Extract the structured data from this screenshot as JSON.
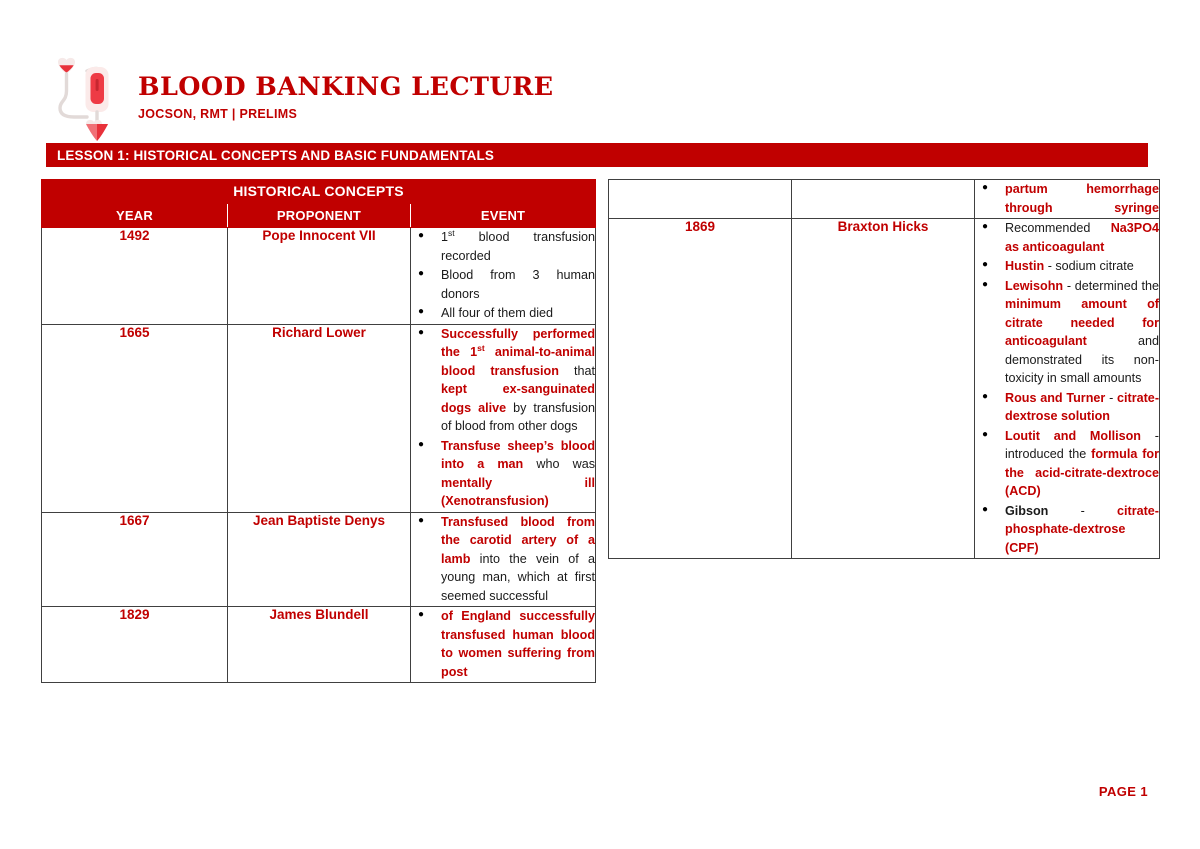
{
  "header": {
    "title": "BLOOD BANKING LECTURE",
    "subtitle": "JOCSON, RMT | PRELIMS",
    "logo_icon": "blood-bag-iv-drip-icon"
  },
  "lesson_banner": {
    "label": "LESSON 1: HISTORICAL CONCEPTS AND BASIC FUNDAMENTALS"
  },
  "colors": {
    "brand_red": "#C00000",
    "banner_bg": "#C00000",
    "header_text": "#FFFFFF",
    "body_text": "#1A1A1A",
    "border": "#404040"
  },
  "left_table": {
    "title": "HISTORICAL CONCEPTS",
    "columns": [
      "YEAR",
      "PROPONENT",
      "EVENT"
    ],
    "rows": [
      {
        "year": "1492",
        "proponent": "Pope Innocent VII",
        "events": [
          "1st blood transfusion recorded",
          "Blood from 3 human donors",
          "All four of them died"
        ]
      },
      {
        "year": "1665",
        "proponent": "Richard Lower",
        "events": [
          "Successfully performed the 1st animal-to-animal blood transfusion that kept ex-sanguinated dogs alive by transfusion of blood from other dogs",
          "Transfuse sheep’s blood into a man who was mentally ill (Xenotransfusion)"
        ]
      },
      {
        "year": "1667",
        "proponent": "Jean Baptiste Denys",
        "events": [
          "Transfused blood from the carotid artery of a lamb into the vein of a young man, which at first seemed successful"
        ]
      },
      {
        "year": "1829",
        "proponent": "James Blundell",
        "events": [
          "of England successfully transfused human blood to women suffering from post"
        ]
      }
    ]
  },
  "right_table": {
    "rows": [
      {
        "year": "",
        "proponent": "",
        "events": [
          "partum hemorrhage through syringe"
        ]
      },
      {
        "year": "1869",
        "proponent": "Braxton Hicks",
        "events": [
          "Recommended Na3PO4 as anticoagulant",
          "Hustin - sodium citrate",
          "Lewisohn - determined the minimum amount of citrate needed for anticoagulant and demonstrated its non-toxicity in small amounts",
          "Rous and Turner - citrate-dextrose solution",
          "Loutit and Mollison - introduced the formula for the acid-citrate-dextroce (ACD)",
          "Gibson - citrate-phosphate-dextrose (CPF)"
        ]
      }
    ]
  },
  "footer": {
    "page_label": "PAGE 1"
  }
}
